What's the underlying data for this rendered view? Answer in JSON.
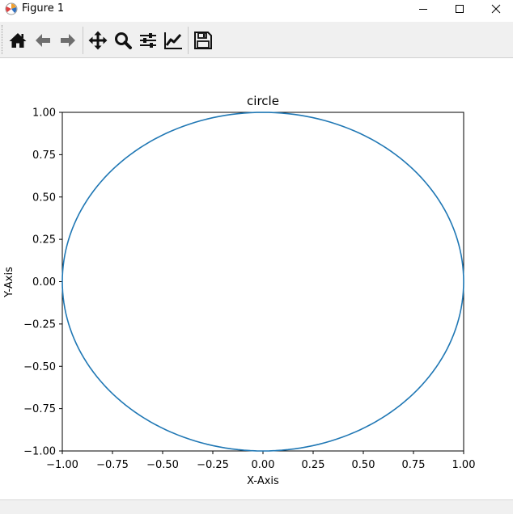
{
  "window": {
    "title": "Figure 1",
    "icon": "matplotlib-icon",
    "controls": [
      "minimize-icon",
      "maximize-icon",
      "close-icon"
    ]
  },
  "toolbar": {
    "buttons": [
      {
        "icon": "home-icon",
        "tooltip": "Home"
      },
      {
        "icon": "back-arrow-icon",
        "tooltip": "Back"
      },
      {
        "icon": "forward-arrow-icon",
        "tooltip": "Forward"
      },
      {
        "icon": "pan-icon",
        "tooltip": "Pan"
      },
      {
        "icon": "zoom-icon",
        "tooltip": "Zoom"
      },
      {
        "icon": "subplots-icon",
        "tooltip": "Subplots"
      },
      {
        "icon": "edit-axis-icon",
        "tooltip": "Customize"
      },
      {
        "icon": "save-icon",
        "tooltip": "Save"
      }
    ]
  },
  "chart_data": {
    "type": "line",
    "title": "circle",
    "xlabel": "X-Axis",
    "ylabel": "Y-Axis",
    "xlim": [
      -1.0,
      1.0
    ],
    "ylim": [
      -1.0,
      1.0
    ],
    "xticks": [
      "−1.00",
      "−0.75",
      "−0.50",
      "−0.25",
      "0.00",
      "0.25",
      "0.50",
      "0.75",
      "1.00"
    ],
    "yticks": [
      "1.00",
      "0.75",
      "0.50",
      "0.25",
      "0.00",
      "−0.25",
      "−0.50",
      "−0.75",
      "−1.00"
    ],
    "grid": false,
    "color": "#1f77b4",
    "series": [
      {
        "equation": "x = cos(t), y = sin(t), t in [0, 2π]",
        "x": [
          1.0,
          0.924,
          0.707,
          0.383,
          0.0,
          -0.383,
          -0.707,
          -0.924,
          -1.0,
          -0.924,
          -0.707,
          -0.383,
          0.0,
          0.383,
          0.707,
          0.924,
          1.0
        ],
        "y": [
          0.0,
          0.383,
          0.707,
          0.924,
          1.0,
          0.924,
          0.707,
          0.383,
          0.0,
          -0.383,
          -0.707,
          -0.924,
          -1.0,
          -0.924,
          -0.707,
          -0.383,
          0.0
        ]
      }
    ]
  }
}
